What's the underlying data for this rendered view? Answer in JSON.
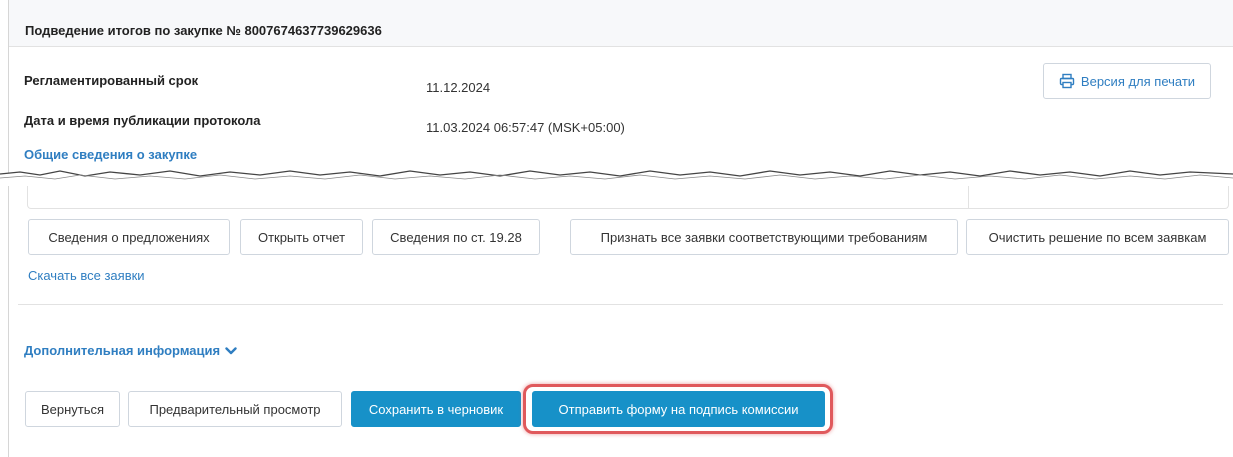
{
  "header": {
    "title": "Подведение итогов по закупке № 8007674637739629636"
  },
  "info": {
    "deadline_label": "Регламентированный срок",
    "deadline_value": "11.12.2024",
    "published_label": "Дата и время публикации протокола",
    "published_value": "11.03.2024 06:57:47 (MSK+05:00)",
    "general_link": "Общие сведения о закупке"
  },
  "print_button": {
    "label": "Версия для печати",
    "icon": "printer-icon"
  },
  "actions": {
    "offers": "Сведения о предложениях",
    "open_report": "Открыть отчет",
    "art_1928": "Сведения по ст. 19.28",
    "accept_all": "Признать все заявки соответствующими требованиям",
    "clear_all": "Очистить решение по всем заявкам"
  },
  "download_all": "Скачать все заявки",
  "additional_info": {
    "label": "Дополнительная информация",
    "icon": "chevron-down-icon"
  },
  "footer": {
    "back": "Вернуться",
    "preview": "Предварительный просмотр",
    "save_draft": "Сохранить в черновик",
    "send": "Отправить форму  на подпись комиссии"
  },
  "colors": {
    "link": "#2f7ec1",
    "primary": "#1791c8",
    "highlight": "#e0595c"
  }
}
